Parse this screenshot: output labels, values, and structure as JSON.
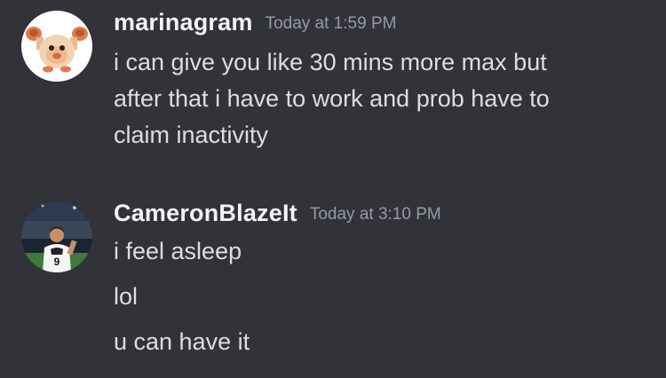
{
  "messages": [
    {
      "username": "marinagram",
      "timestamp": "Today at 1:59 PM",
      "avatar_icon": "monkey-pokemon-avatar",
      "lines": [
        "i can give you like 30 mins more max but",
        "after that i have to work and prob have to",
        "claim inactivity"
      ]
    },
    {
      "username": "CameronBlazeIt",
      "timestamp": "Today at 3:10 PM",
      "avatar_icon": "football-player-avatar",
      "lines": [
        "i feel asleep",
        "lol",
        "u can have it"
      ]
    }
  ],
  "colors": {
    "background": "#313338",
    "username": "#f2f3f5",
    "timestamp": "#949ba4",
    "text": "#dbdee1"
  }
}
